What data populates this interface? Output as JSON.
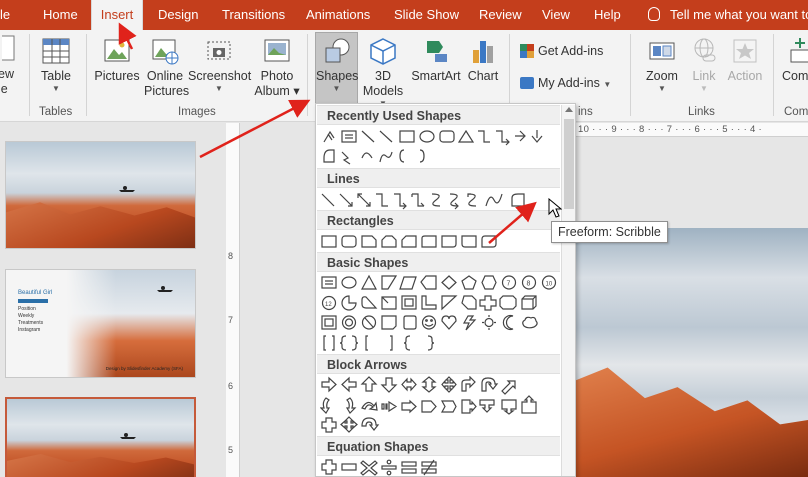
{
  "tabs": [
    "le",
    "Home",
    "Insert",
    "Design",
    "Transitions",
    "Animations",
    "Slide Show",
    "Review",
    "View",
    "Help"
  ],
  "active_tab": "Insert",
  "tell_me": "Tell me what you want to",
  "ribbon": {
    "new_slide": {
      "line1": "ew",
      "line2": "le"
    },
    "table": "Table",
    "pictures": "Pictures",
    "online_pictures_1": "Online",
    "online_pictures_2": "Pictures",
    "screenshot": "Screenshot",
    "photo_album_1": "Photo",
    "photo_album_2": "Album",
    "shapes": "Shapes",
    "models_1": "3D",
    "models_2": "Models",
    "smartart": "SmartArt",
    "chart": "Chart",
    "get_addins": "Get Add-ins",
    "my_addins": "My Add-ins",
    "zoom": "Zoom",
    "link": "Link",
    "action": "Action",
    "comment": "Com",
    "groups": {
      "tables": "Tables",
      "images": "Images",
      "addins": "ins",
      "links": "Links",
      "comments": "Com"
    }
  },
  "shapes_menu": {
    "sections": [
      "Recently Used Shapes",
      "Lines",
      "Rectangles",
      "Basic Shapes",
      "Block Arrows",
      "Equation Shapes"
    ]
  },
  "tooltip": "Freeform: Scribble",
  "ruler": {
    "horizontal": "10 · · · 9 · · · 8 · · · 7 · · · 6 · · · 5 · · · 4 ·",
    "vertical": [
      "8",
      "7",
      "6",
      "5"
    ]
  },
  "slide2": {
    "title": "Beautiful Girl",
    "lines": [
      "Position",
      "Weekly",
      "Treatments",
      "Instagram"
    ],
    "caption": "Design by Slidesfinder Academy (SFA)"
  },
  "colors": {
    "accent": "#c43e1c",
    "arrow": "#e0221b"
  }
}
